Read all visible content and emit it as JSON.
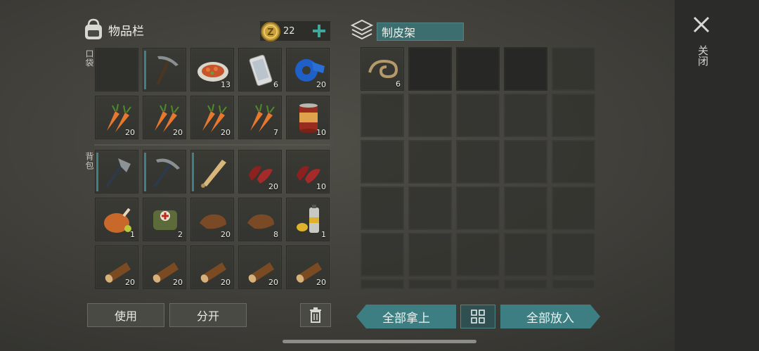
{
  "inventory": {
    "title": "物品栏",
    "coins": "22",
    "pocket_label": "口袋",
    "backpack_label": "背包",
    "slots": [
      {
        "qty": ""
      },
      {
        "qty": ""
      },
      {
        "qty": "13"
      },
      {
        "qty": "6"
      },
      {
        "qty": "20"
      },
      {
        "qty": "20"
      },
      {
        "qty": "20"
      },
      {
        "qty": "20"
      },
      {
        "qty": "7"
      },
      {
        "qty": "10"
      },
      {
        "qty": ""
      },
      {
        "qty": ""
      },
      {
        "qty": ""
      },
      {
        "qty": "20"
      },
      {
        "qty": "10"
      },
      {
        "qty": "1"
      },
      {
        "qty": "2"
      },
      {
        "qty": "20"
      },
      {
        "qty": "8"
      },
      {
        "qty": "1"
      },
      {
        "qty": "20"
      },
      {
        "qty": "20"
      },
      {
        "qty": "20"
      },
      {
        "qty": "20"
      },
      {
        "qty": "20"
      }
    ],
    "use_label": "使用",
    "split_label": "分开"
  },
  "station": {
    "title": "制皮架",
    "slot0_qty": "6",
    "take_all_label": "全部拿上",
    "put_all_label": "全部放入"
  },
  "close_label": "关闭",
  "colors": {
    "accent": "#3c7e82",
    "durability": "#3e7f8a",
    "plus": "#3fa89a"
  }
}
